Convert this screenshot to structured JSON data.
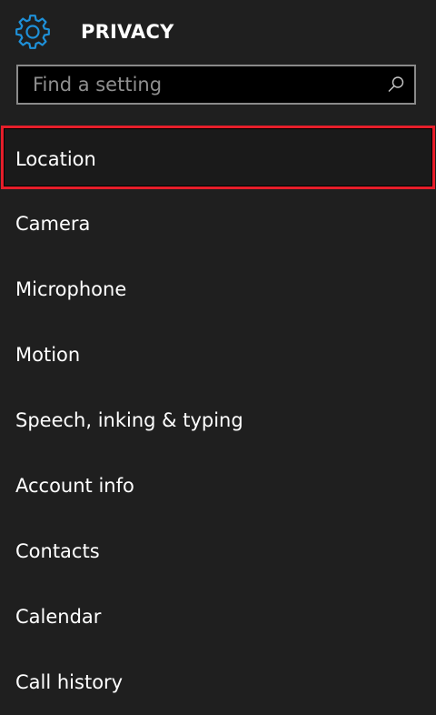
{
  "header": {
    "title": "PRIVACY",
    "icon": "gear-icon",
    "accent_color": "#1e90d8"
  },
  "search": {
    "placeholder": "Find a setting",
    "value": "",
    "icon": "search-icon"
  },
  "items": [
    {
      "label": "Location",
      "selected": true
    },
    {
      "label": "Camera"
    },
    {
      "label": "Microphone"
    },
    {
      "label": "Motion"
    },
    {
      "label": "Speech, inking & typing"
    },
    {
      "label": "Account info"
    },
    {
      "label": "Contacts"
    },
    {
      "label": "Calendar"
    },
    {
      "label": "Call history"
    }
  ],
  "highlight_color": "#e61e2a"
}
